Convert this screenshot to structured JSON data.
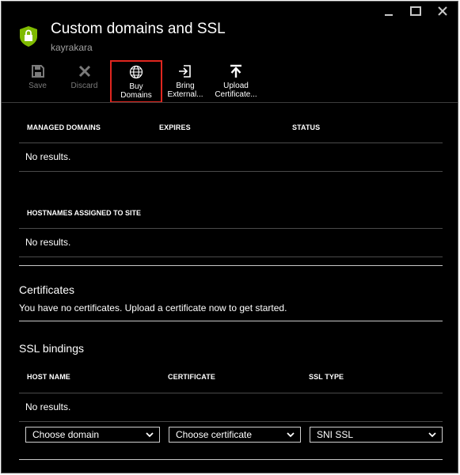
{
  "window": {
    "minimize_icon": "minimize-icon",
    "maximize_icon": "maximize-icon",
    "close_icon": "close-icon"
  },
  "header": {
    "title": "Custom domains and SSL",
    "subtitle": "kayrakara",
    "icon": "shield-lock-icon",
    "icon_color": "#7fba00"
  },
  "commands": {
    "save": {
      "label": "Save",
      "icon": "save-icon"
    },
    "discard": {
      "label": "Discard",
      "icon": "discard-icon"
    },
    "buy_domains": {
      "label_line1": "Buy",
      "label_line2": "Domains",
      "icon": "globe-icon"
    },
    "bring_external": {
      "label_line1": "Bring",
      "label_line2": "External...",
      "icon": "import-icon"
    },
    "upload_certificate": {
      "label_line1": "Upload",
      "label_line2": "Certificate...",
      "icon": "upload-icon"
    }
  },
  "managed_domains": {
    "columns": [
      "MANAGED DOMAINS",
      "EXPIRES",
      "STATUS"
    ],
    "empty_text": "No results."
  },
  "hostnames": {
    "column": "HOSTNAMES ASSIGNED TO SITE",
    "empty_text": "No results."
  },
  "certificates": {
    "title": "Certificates",
    "message": "You have no certificates. Upload a certificate now to get started."
  },
  "ssl_bindings": {
    "title": "SSL bindings",
    "columns": [
      "HOST NAME",
      "CERTIFICATE",
      "SSL TYPE"
    ],
    "empty_text": "No results.",
    "domain_select": "Choose domain",
    "certificate_select": "Choose certificate",
    "ssl_type_select": "SNI SSL"
  },
  "colors": {
    "background": "#000000",
    "highlight_border": "#e0261f",
    "divider": "#4a4a4a"
  }
}
